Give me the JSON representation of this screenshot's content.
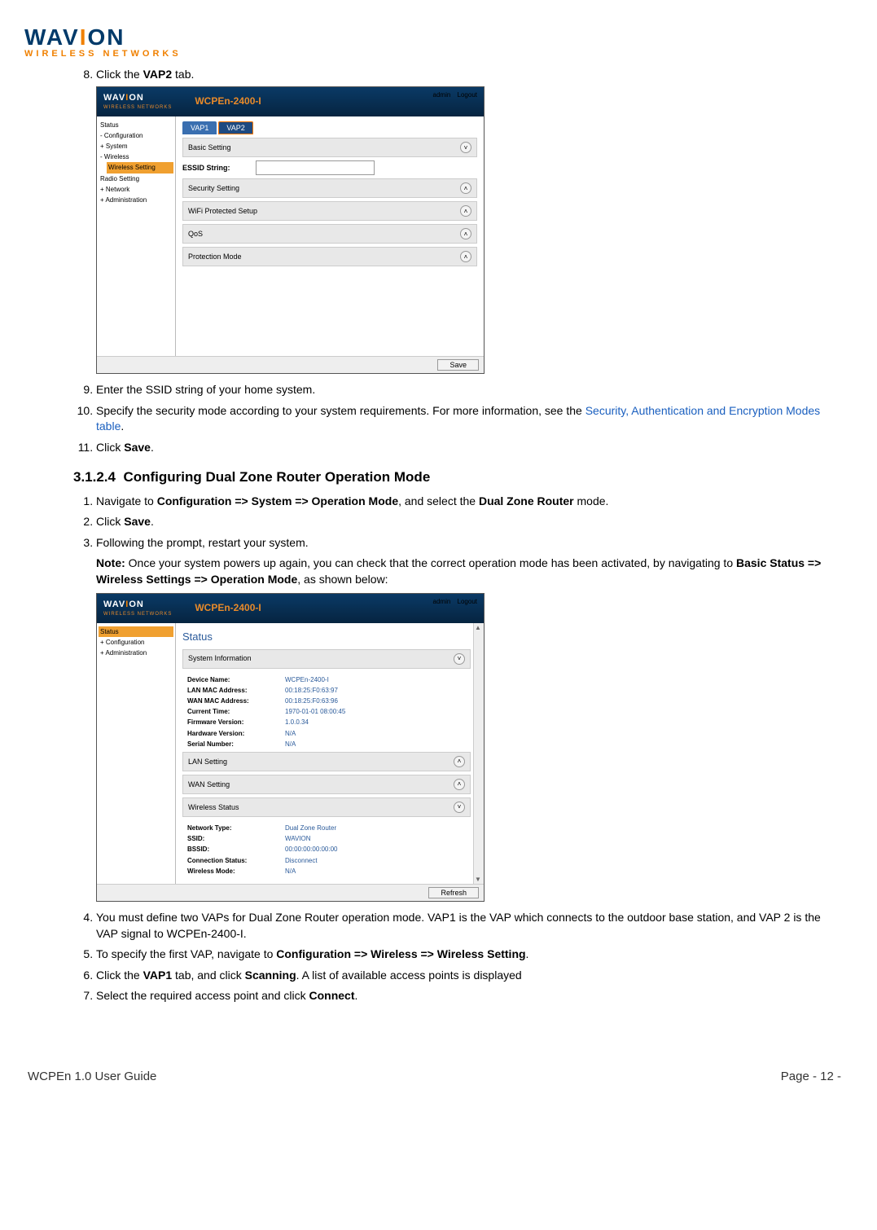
{
  "logo": {
    "brand": "WAV",
    "brand2": "ON",
    "dotLetter": "I",
    "sub": "WIRELESS NETWORKS"
  },
  "steps_a": {
    "s8_pre": "Click the ",
    "s8_b": "VAP2",
    "s8_post": " tab.",
    "s9": "Enter the SSID string of your home system.",
    "s10_pre": "Specify the security mode according to your system requirements. For more information, see the ",
    "s10_link": "Security, Authentication and Encryption Modes table",
    "s10_post": ".",
    "s11_pre": "Click ",
    "s11_b": "Save",
    "s11_post": "."
  },
  "section": {
    "num": "3.1.2.4",
    "title": "Configuring Dual Zone Router Operation Mode"
  },
  "steps_b": {
    "s1_pre": "Navigate to ",
    "s1_b": "Configuration => System => Operation Mode",
    "s1_mid": ", and select the ",
    "s1_b2": "Dual Zone Router",
    "s1_post": " mode.",
    "s2_pre": "Click ",
    "s2_b": "Save",
    "s2_post": ".",
    "s3": "Following the prompt, restart your system.",
    "note_b": "Note:",
    "note_pre": " Once your system powers up again, you can check that the correct operation mode has been activated, by navigating to ",
    "note_path": "Basic Status => Wireless Settings => Operation Mode",
    "note_post": ", as shown below:",
    "s4": "You must define two VAPs for Dual Zone Router operation mode. VAP1 is the VAP which connects to the outdoor base station, and VAP 2 is the VAP signal to WCPEn-2400-I.",
    "s5_pre": "To specify the first VAP, navigate to ",
    "s5_b": "Configuration => Wireless => Wireless Setting",
    "s5_post": ".",
    "s6_pre": "Click the ",
    "s6_b1": "VAP1",
    "s6_mid": " tab, and click ",
    "s6_b2": "Scanning",
    "s6_post": ". A list of available access points is displayed",
    "s7_pre": "Select the required access point and click ",
    "s7_b": "Connect",
    "s7_post": "."
  },
  "ss1": {
    "title": "WCPEn-2400-I",
    "user": "admin",
    "logout": "Logout",
    "side": [
      "Status",
      "- Configuration",
      "  + System",
      "  - Wireless",
      "Wireless Setting",
      "      Radio Setting",
      "  + Network",
      "+ Administration"
    ],
    "tabs": [
      "VAP1",
      "VAP2"
    ],
    "panels": [
      "Basic Setting",
      "Security Setting",
      "WiFi Protected Setup",
      "QoS",
      "Protection Mode"
    ],
    "essid_label": "ESSID String:",
    "save": "Save"
  },
  "ss2": {
    "title": "WCPEn-2400-I",
    "user": "admin",
    "logout": "Logout",
    "side": [
      "Status",
      "+ Configuration",
      "+ Administration"
    ],
    "status_title": "Status",
    "panels_top": "System Information",
    "sysinfo": [
      {
        "k": "Device Name:",
        "v": "WCPEn-2400-I"
      },
      {
        "k": "LAN MAC Address:",
        "v": "00:18:25:F0:63:97"
      },
      {
        "k": "WAN MAC Address:",
        "v": "00:18:25:F0:63:96"
      },
      {
        "k": "Current Time:",
        "v": "1970-01-01 08:00:45"
      },
      {
        "k": "Firmware Version:",
        "v": "1.0.0.34"
      },
      {
        "k": "Hardware Version:",
        "v": "N/A"
      },
      {
        "k": "Serial Number:",
        "v": "N/A"
      }
    ],
    "panels_mid": [
      "LAN Setting",
      "WAN Setting",
      "Wireless Status"
    ],
    "wstatus": [
      {
        "k": "Network Type:",
        "v": "Dual Zone Router"
      },
      {
        "k": "SSID:",
        "v": "WAVION"
      },
      {
        "k": "BSSID:",
        "v": "00:00:00:00:00:00"
      },
      {
        "k": "Connection Status:",
        "v": "Disconnect"
      },
      {
        "k": "Wireless Mode:",
        "v": "N/A"
      }
    ],
    "refresh": "Refresh"
  },
  "footer": {
    "left": "WCPEn 1.0 User Guide",
    "right": "Page - 12 -"
  }
}
